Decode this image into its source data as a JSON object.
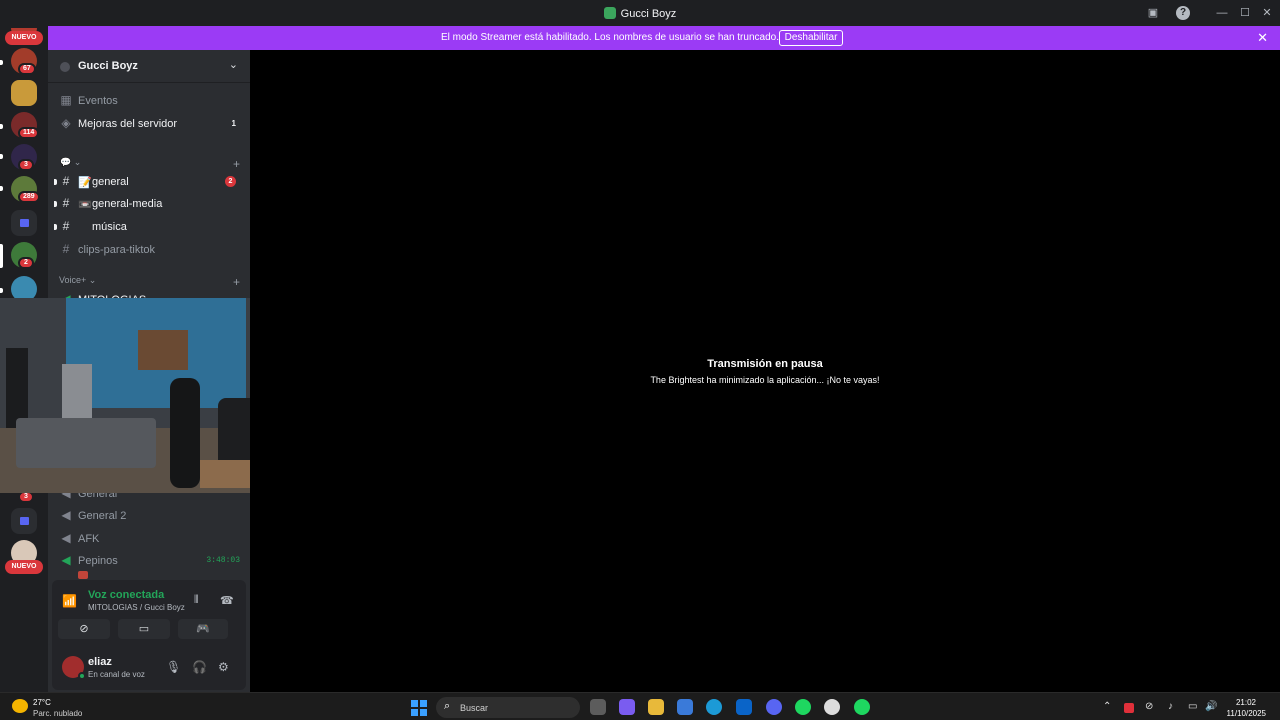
{
  "window": {
    "title": "Gucci Boyz"
  },
  "banner": {
    "message": "El modo Streamer está habilitado. Los nombres de usuario se han truncado.",
    "button_label": "Deshabilitar"
  },
  "guilds": {
    "nuevo_label": "NUEVO",
    "badges": [
      "67",
      "114",
      "3",
      "289",
      "2",
      "3"
    ]
  },
  "server": {
    "name": "Gucci Boyz",
    "events_label": "Eventos",
    "boosts_label": "Mejoras del servidor",
    "boosts_count": "1"
  },
  "channels": {
    "text_category": "💬 ⌄",
    "text": [
      {
        "name": "general",
        "prefix": "📝",
        "badge": "2"
      },
      {
        "name": "general-media",
        "prefix": "📼"
      },
      {
        "name": "música",
        "prefix": ""
      },
      {
        "name": "clips-para-tiktok",
        "prefix": ""
      }
    ],
    "voice_category": "Voice+ ⌄",
    "voice_partial": "MITOLOGIAS",
    "voice": [
      {
        "name": "General"
      },
      {
        "name": "General 2"
      },
      {
        "name": "AFK"
      },
      {
        "name": "Pepinos",
        "time": "3:48:03"
      }
    ]
  },
  "voice_connection": {
    "title": "Voz conectada",
    "subtitle": "MITOLOGIAS / Gucci Boyz"
  },
  "user": {
    "name": "eliaz",
    "status": "En canal de voz"
  },
  "stream": {
    "title": "Transmisión en pausa",
    "subtitle": "The Brightest ha minimizado la aplicación... ¡No te vayas!"
  },
  "taskbar": {
    "temp": "27°C",
    "weather": "Parc. nublado",
    "search_placeholder": "Buscar",
    "time": "21:02",
    "date": "11/10/2025"
  },
  "colors": {
    "banner": "#9b3bf5",
    "connected": "#23a559",
    "mention": "#da373c",
    "background": "#000000"
  }
}
